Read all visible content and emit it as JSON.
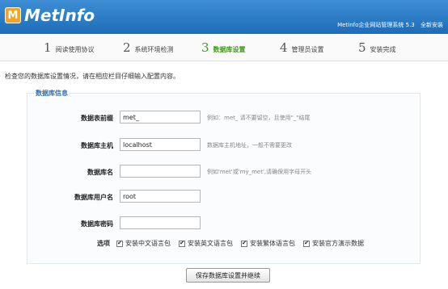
{
  "header": {
    "logo_badge": "M",
    "logo_text": "MetInfo",
    "system_name": "MetInfo企业网站管理系统 5.3",
    "install_label": "全新安装"
  },
  "steps": [
    {
      "num": "1",
      "label": "阅读使用协议",
      "active": false
    },
    {
      "num": "2",
      "label": "系统环境检测",
      "active": false
    },
    {
      "num": "3",
      "label": "数据库设置",
      "active": true
    },
    {
      "num": "4",
      "label": "管理员设置",
      "active": false
    },
    {
      "num": "5",
      "label": "安装完成",
      "active": false
    }
  ],
  "intro": "检查您的数据库设置情况，请在相应栏目仔细输入配置内容。",
  "panel_title": "数据库信息",
  "form": {
    "prefix": {
      "label": "数据表前缀",
      "value": "met_",
      "hint": "例如：met_ 请不要留空，且使用\"_\"结尾"
    },
    "host": {
      "label": "数据库主机",
      "value": "localhost",
      "hint": "数据库主机地址，一般不需要更改"
    },
    "name": {
      "label": "数据库名",
      "value": "",
      "hint": "例如'met'或'my_met',请确保用字母开头"
    },
    "user": {
      "label": "数据库用户名",
      "value": "root",
      "hint": ""
    },
    "password": {
      "label": "数据库密码",
      "value": "",
      "hint": ""
    }
  },
  "options": {
    "label": "选项",
    "items": [
      {
        "label": "安装中文语言包",
        "checked": true
      },
      {
        "label": "安装英文语言包",
        "checked": true
      },
      {
        "label": "安装繁体语言包",
        "checked": true
      },
      {
        "label": "安装官方演示数据",
        "checked": true
      }
    ]
  },
  "submit_label": "保存数据库设置并继续",
  "colors": {
    "header": "#2a7cc8",
    "active_step": "#3b9b1b",
    "panel_title": "#2d6fb4",
    "logo_badge": "#f5a321"
  }
}
